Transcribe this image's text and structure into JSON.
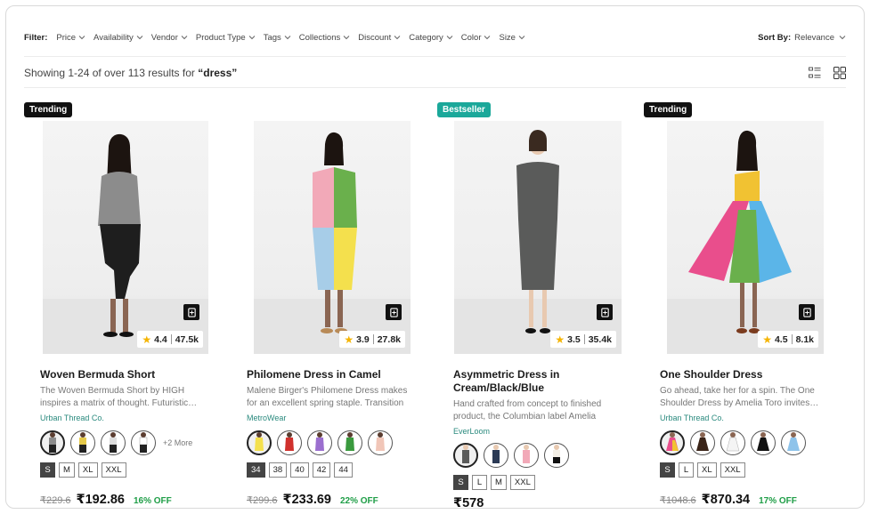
{
  "filters": {
    "label": "Filter:",
    "items": [
      "Price",
      "Availability",
      "Vendor",
      "Product Type",
      "Tags",
      "Collections",
      "Discount",
      "Category",
      "Color",
      "Size"
    ]
  },
  "sort": {
    "label": "Sort By:",
    "value": "Relevance"
  },
  "results": {
    "prefix": "Showing 1-24 of over 113 results for",
    "query": "“dress”"
  },
  "products": [
    {
      "badge": "Trending",
      "rating": "4.4",
      "reviews": "47.5k",
      "title": "Woven Bermuda Short",
      "desc": "The Woven Bermuda Short by HIGH inspires a matrix of thought. Futuristic…",
      "vendor": "Urban Thread Co.",
      "more": "+2 More",
      "sizes": [
        "S",
        "M",
        "XL",
        "XXL"
      ],
      "old_price": "₹229.6",
      "price": "₹192.86",
      "off": "16% OFF"
    },
    {
      "badge": "",
      "rating": "3.9",
      "reviews": "27.8k",
      "title": "Philomene Dress in Camel",
      "desc": "Malene Birger's Philomene Dress makes for an excellent spring staple. Transition from…",
      "vendor": "MetroWear",
      "more": "",
      "sizes": [
        "34",
        "38",
        "40",
        "42",
        "44"
      ],
      "old_price": "₹299.6",
      "price": "₹233.69",
      "off": "22% OFF"
    },
    {
      "badge": "Bestseller",
      "rating": "3.5",
      "reviews": "35.4k",
      "title": "Asymmetric Dress in Cream/Black/Blue",
      "desc": "Hand crafted from concept to finished product, the Columbian label Amelia Toro…",
      "vendor": "EverLoom",
      "more": "",
      "sizes": [
        "S",
        "L",
        "M",
        "XXL"
      ],
      "old_price": "",
      "price": "₹578",
      "off": ""
    },
    {
      "badge": "Trending",
      "rating": "4.5",
      "reviews": "8.1k",
      "title": "One Shoulder Dress",
      "desc": "Go ahead, take her for a spin. The One Shoulder Dress by Amelia Toro invites…",
      "vendor": "Urban Thread Co.",
      "more": "",
      "sizes": [
        "S",
        "L",
        "XL",
        "XXL"
      ],
      "old_price": "₹1048.6",
      "price": "₹870.34",
      "off": "17% OFF"
    }
  ],
  "colors": {
    "bestseller": "#1ba89a",
    "discount": "#1f9e47",
    "vendor": "#2a8a7e",
    "star": "#f5b400"
  }
}
